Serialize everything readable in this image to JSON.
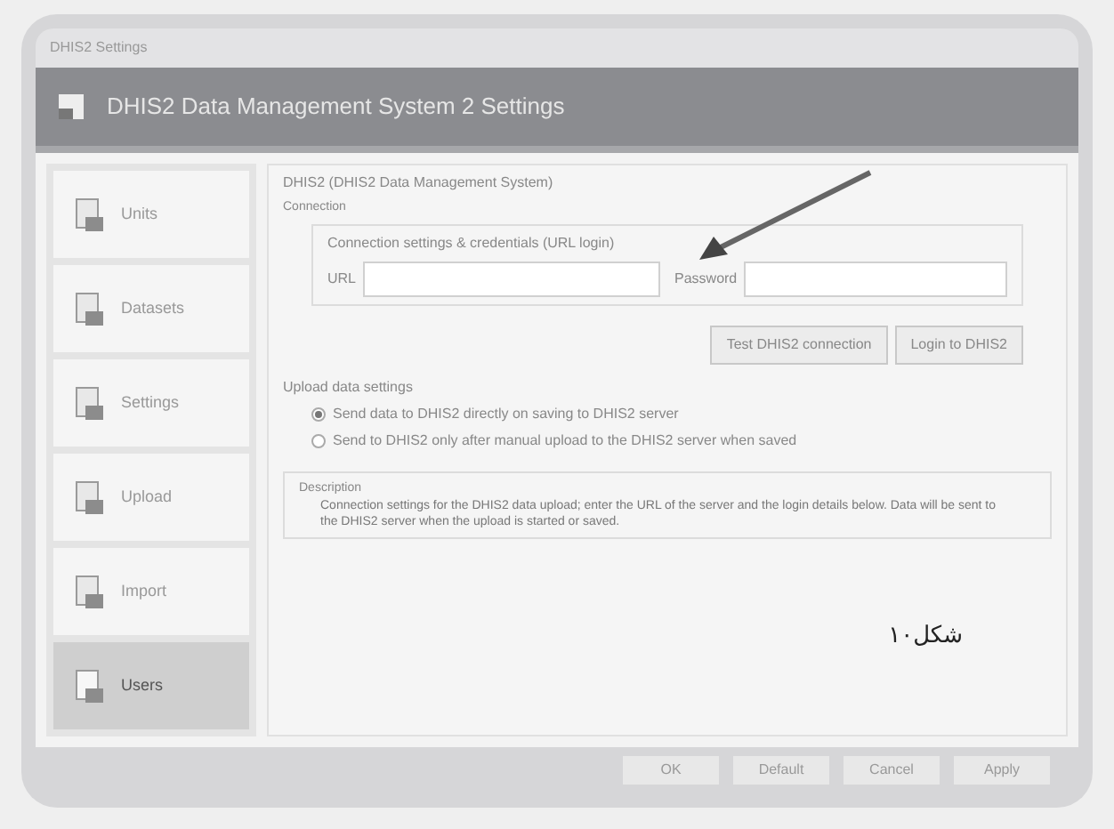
{
  "window": {
    "caption": "DHIS2 Settings",
    "title": "DHIS2 Data Management System 2 Settings"
  },
  "sidebar": {
    "items": [
      {
        "label": "Units",
        "selected": false
      },
      {
        "label": "Datasets",
        "selected": false
      },
      {
        "label": "Settings",
        "selected": false
      },
      {
        "label": "Upload",
        "selected": false
      },
      {
        "label": "Import",
        "selected": false
      },
      {
        "label": "Users",
        "selected": true
      }
    ]
  },
  "panel": {
    "title": "DHIS2 (DHIS2 Data Management System)",
    "section": "Connection",
    "group_title": "Connection settings & credentials (URL login)",
    "fields": [
      {
        "label": "URL"
      },
      {
        "label": "Password"
      }
    ],
    "buttons": [
      "Test DHIS2 connection",
      "Login to DHIS2"
    ],
    "upload_title": "Upload data settings",
    "options": [
      {
        "label": "Send data to DHIS2 directly on saving to DHIS2 server",
        "selected": true
      },
      {
        "label": "Send to DHIS2 only after manual upload to the DHIS2 server when saved",
        "selected": false
      }
    ],
    "description_title": "Description",
    "description": "Connection settings for the DHIS2 data upload; enter the URL of the server and the login details below. Data will be sent to the DHIS2 server when the upload is started or saved."
  },
  "caption": "شکل۱۰",
  "footer_buttons": [
    "OK",
    "Default",
    "Cancel",
    "Apply"
  ]
}
